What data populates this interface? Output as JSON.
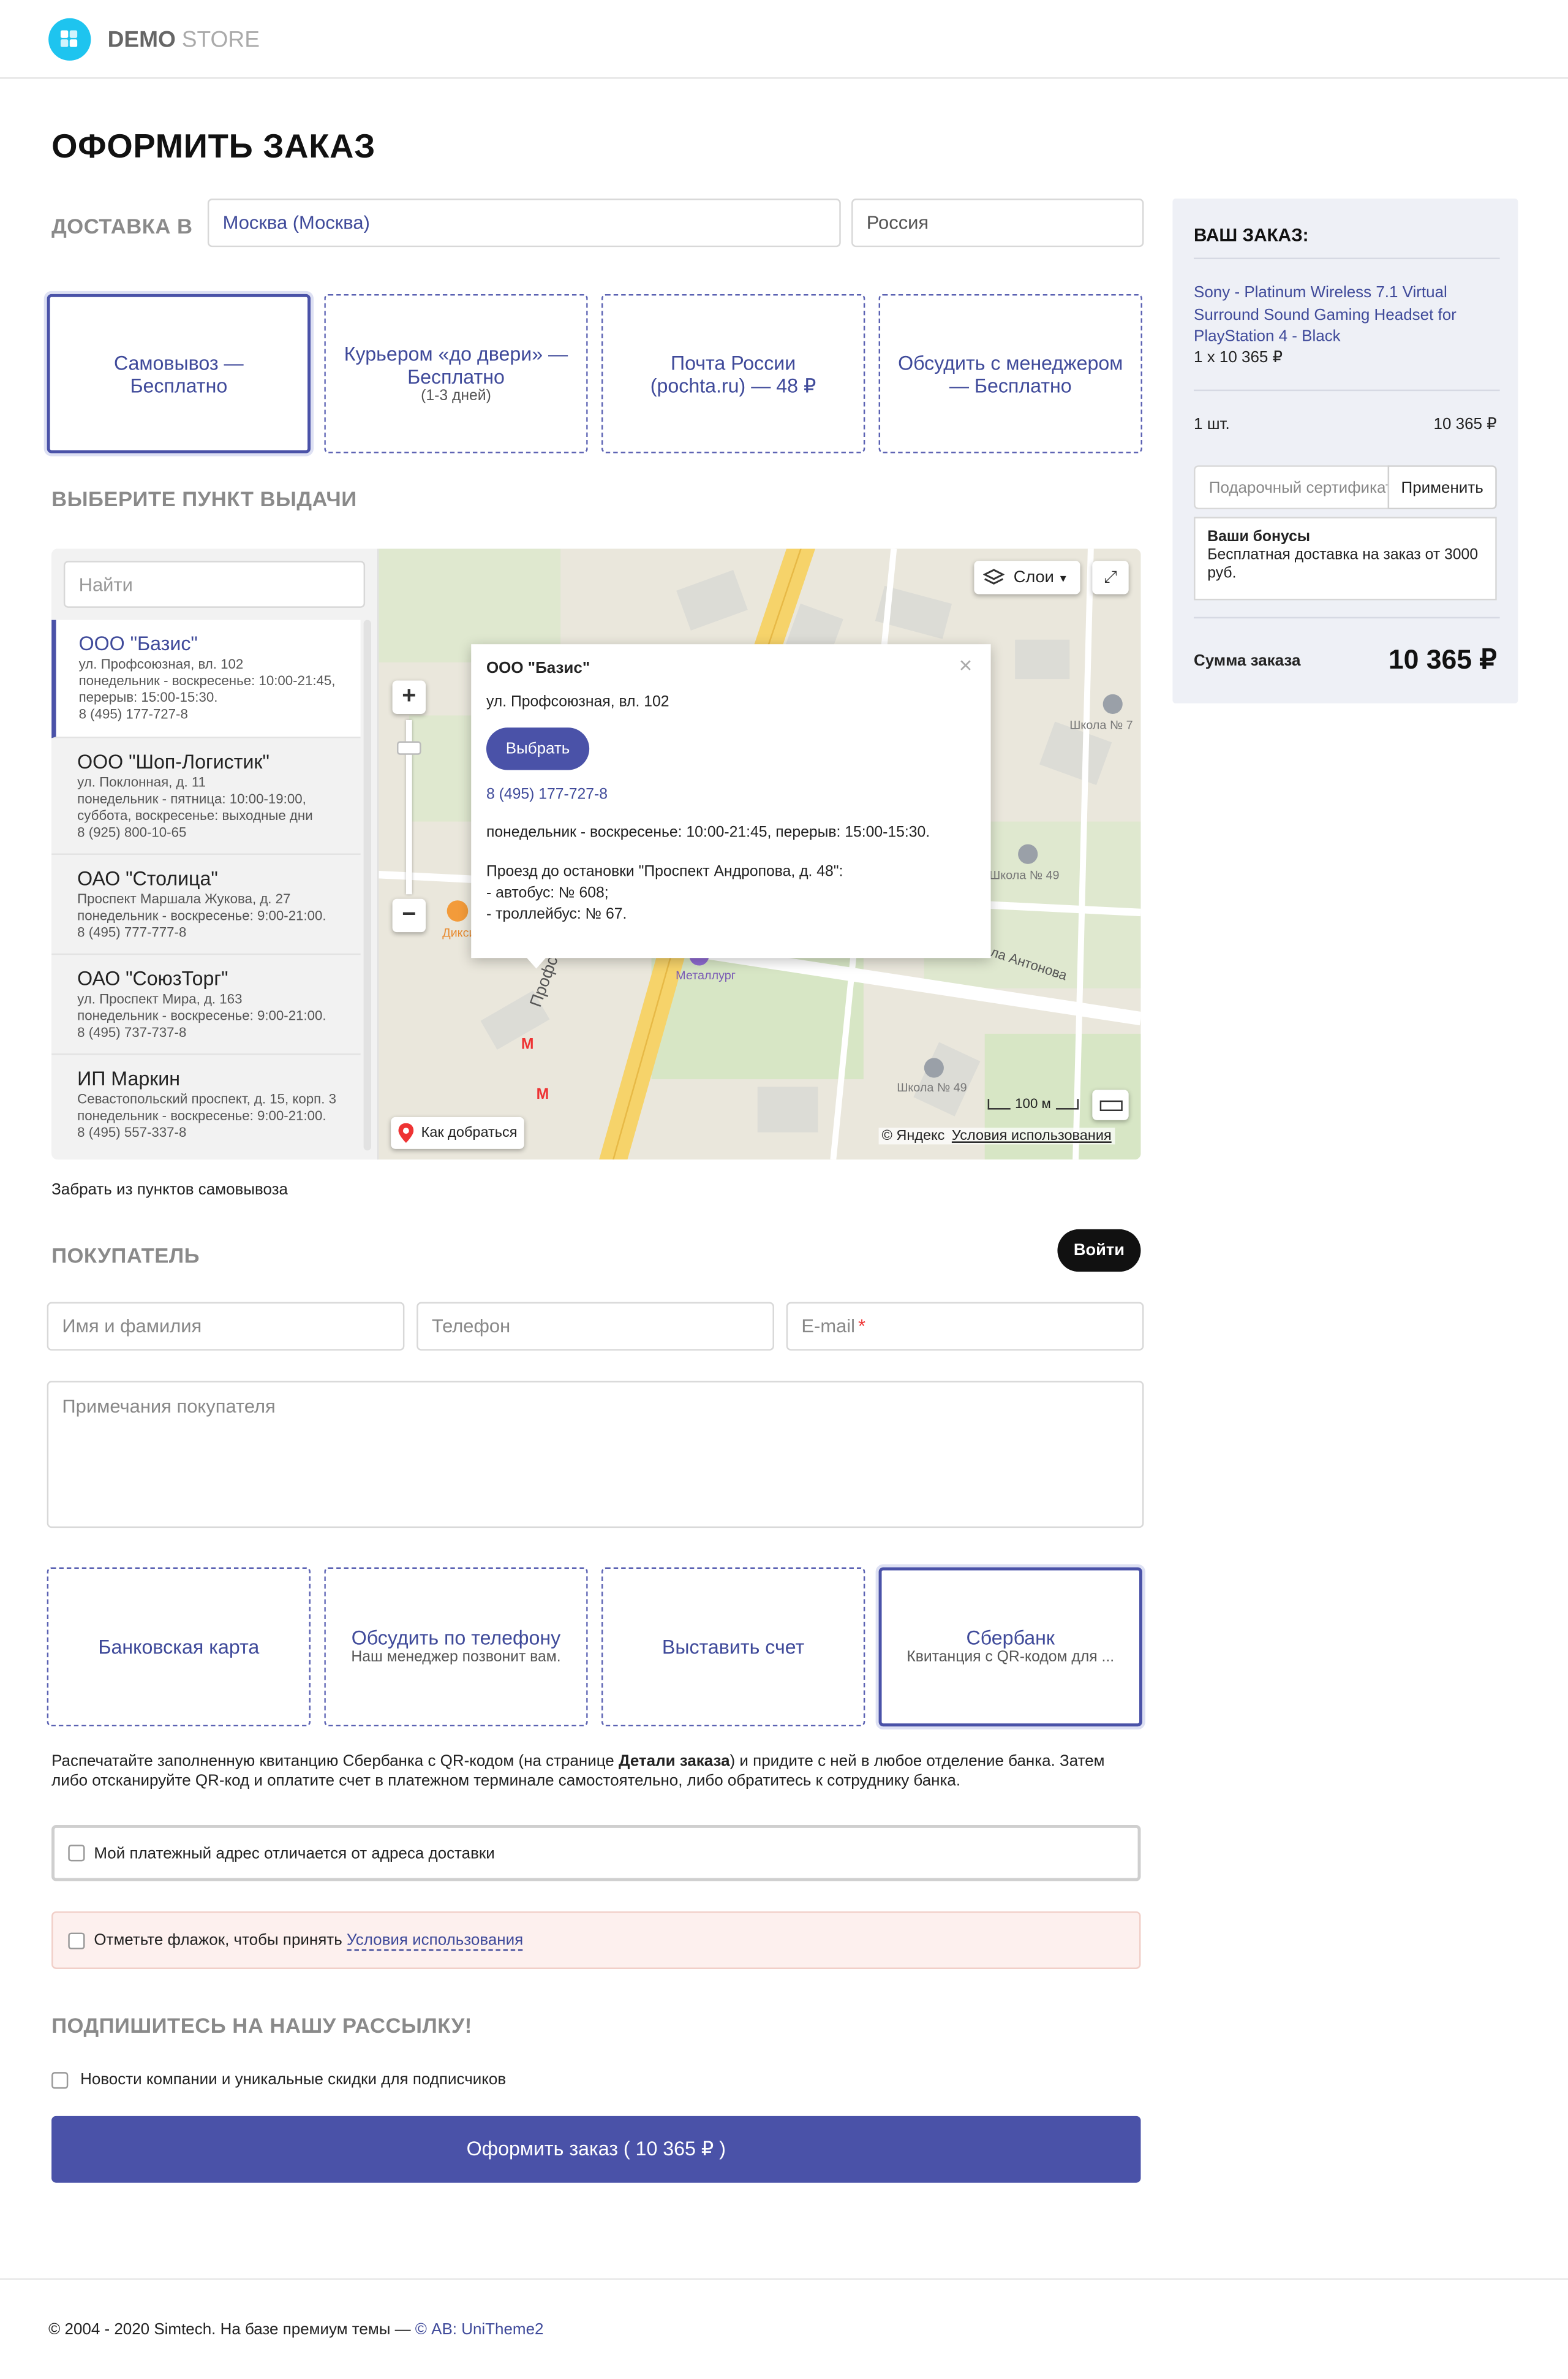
{
  "header": {
    "logo_main": "DEMO",
    "logo_sub": "STORE"
  },
  "page_title": "ОФОРМИТЬ ЗАКАЗ",
  "delivery": {
    "label": "ДОСТАВКА В",
    "city": "Москва (Москва)",
    "country": "Россия",
    "options": [
      {
        "title": "Самовывоз — Бесплатно",
        "sub": ""
      },
      {
        "title": "Курьером «до двери» — Бесплатно",
        "sub": "(1-3 дней)"
      },
      {
        "title": "Почта России (pochta.ru) — 48 ₽",
        "sub": ""
      },
      {
        "title": "Обсудить с менеджером — Бесплатно",
        "sub": ""
      }
    ]
  },
  "pickup": {
    "header": "ВЫБЕРИТЕ ПУНКТ ВЫДАЧИ",
    "search_placeholder": "Найти",
    "points": [
      {
        "name": "ООО \"Базис\"",
        "address": "ул. Профсоюзная, вл. 102",
        "hours": "понедельник - воскресенье: 10:00-21:45, перерыв: 15:00-15:30.",
        "phone": "8 (495) 177-727-8"
      },
      {
        "name": "ООО \"Шоп-Логистик\"",
        "address": "ул. Поклонная, д. 11",
        "hours": "понедельник - пятница: 10:00-19:00, суббота, воскресенье: выходные дни",
        "phone": "8 (925) 800-10-65"
      },
      {
        "name": "ОАО \"Столица\"",
        "address": "Проспект Маршала Жукова, д. 27",
        "hours": "понедельник - воскресенье: 9:00-21:00.",
        "phone": "8 (495) 777-777-8"
      },
      {
        "name": "ОАО \"СоюзТорг\"",
        "address": "ул. Проспект Мира, д. 163",
        "hours": "понедельник - воскресенье: 9:00-21:00.",
        "phone": "8 (495) 737-737-8"
      },
      {
        "name": "ИП Маркин",
        "address": "Севастопольский проспект, д. 15, корп. 3",
        "hours": "понедельник - воскресенье: 9:00-21:00.",
        "phone": "8 (495) 557-337-8"
      }
    ],
    "note": "Забрать из пунктов самовывоза"
  },
  "map": {
    "layers_label": "Слои",
    "route_label": "Как добраться",
    "scale_label": "100 м",
    "copyright": "© Яндекс",
    "terms": "Условия использования",
    "labels": {
      "school1": "Школа № 7",
      "school2": "Школа № 49",
      "school3": "Школа № 49",
      "metro": "Металлург",
      "street1": "Профсоюзная",
      "street2": "ала Антонова",
      "shop": "Дикси"
    },
    "popup": {
      "title": "ООО \"Базис\"",
      "address": "ул. Профсоюзная, вл. 102",
      "button": "Выбрать",
      "phone": "8 (495) 177-727-8",
      "hours": "понедельник - воскресенье: 10:00-21:45, перерыв: 15:00-15:30.",
      "directions_title": "Проезд до остановки \"Проспект Андропова, д. 48\":",
      "bus": "- автобус: № 608;",
      "trolley": "- троллейбус: № 67."
    }
  },
  "customer": {
    "header": "ПОКУПАТЕЛЬ",
    "login": "Войти",
    "name_placeholder": "Имя и фамилия",
    "phone_placeholder": "Телефон",
    "email_placeholder": "E-mail",
    "required_mark": "*",
    "notes_placeholder": "Примечания покупателя"
  },
  "payment": {
    "options": [
      {
        "title": "Банковская карта",
        "sub": ""
      },
      {
        "title": "Обсудить по телефону",
        "sub": "Наш менеджер позвонит вам."
      },
      {
        "title": "Выставить счет",
        "sub": ""
      },
      {
        "title": "Сбербанк",
        "sub": "Квитанция с QR-кодом для ..."
      }
    ],
    "info_a": "Распечатайте заполненную квитанцию Сбербанка с QR-кодом (на странице ",
    "info_bold": "Детали заказа",
    "info_b": ") и придите с ней в любое отделение банка. Затем либо отсканируйте QR-код и оплатите счет в платежном терминале самостоятельно, либо обратитесь к сотруднику банка."
  },
  "billing_diff": "Мой платежный адрес отличается от адреса доставки",
  "terms": {
    "text": "Отметьте флажок, чтобы принять ",
    "link": "Условия использования"
  },
  "newsletter": {
    "header": "ПОДПИШИТЕСЬ НА НАШУ РАССЫЛКУ!",
    "label": "Новости компании и уникальные скидки для подписчиков"
  },
  "place_order": "Оформить заказ ( 10 365 ₽ )",
  "sidebar": {
    "title": "ВАШ ЗАКАЗ:",
    "product_name": "Sony - Platinum Wireless 7.1 Virtual Surround Sound Gaming Headset for PlayStation 4 - Black",
    "product_qty_price": "1 x 10 365 ₽",
    "qty": "1 шт.",
    "line_total": "10 365 ₽",
    "gift_placeholder": "Подарочный сертификат",
    "apply": "Применить",
    "bonus_title": "Ваши бонусы",
    "bonus_text": "Бесплатная доставка на заказ от 3000 руб.",
    "total_label": "Сумма заказа",
    "total_value": "10 365 ₽"
  },
  "footer": {
    "text": "© 2004 - 2020 Simtech. На базе премиум темы — ",
    "link": "© AB: UniTheme2"
  },
  "colors": {
    "accent": "#4a52a8",
    "link": "#3f4a9a",
    "sidebar_bg": "#eef0f6",
    "logo": "#1ec4ef"
  }
}
